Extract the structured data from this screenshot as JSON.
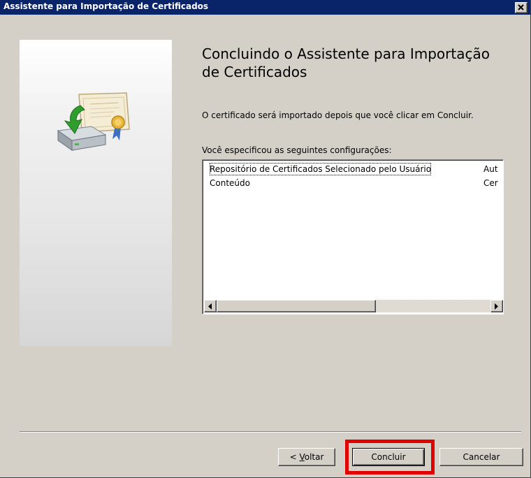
{
  "window": {
    "title": "Assistente para Importação de Certificados"
  },
  "icons": {
    "close": "close-icon",
    "wizard": "certificate-import-icon",
    "scroll_left": "arrow-left-icon",
    "scroll_right": "arrow-right-icon"
  },
  "content": {
    "heading": "Concluindo o Assistente para Importação de Certificados",
    "description": "O certificado será importado depois que você clicar em Concluir.",
    "settings_label": "Você especificou as seguintes configurações:",
    "settings": [
      {
        "key": "Repositório de Certificados Selecionado pelo Usuário",
        "value": "Aut"
      },
      {
        "key": "Conteúdo",
        "value": "Cer"
      }
    ]
  },
  "buttons": {
    "back_prefix": "< ",
    "back_mnemonic": "V",
    "back_rest": "oltar",
    "finish": "Concluir",
    "cancel": "Cancelar"
  },
  "colors": {
    "titlebar": "#0a246a",
    "face": "#d4d0c8",
    "highlight": "#e00000"
  }
}
